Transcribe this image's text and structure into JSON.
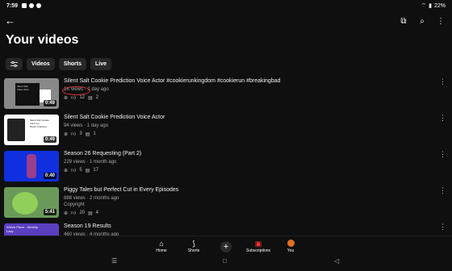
{
  "status": {
    "time": "7:59",
    "battery": "22%"
  },
  "page": {
    "title": "Your videos"
  },
  "chips": [
    "Videos",
    "Shorts",
    "Live"
  ],
  "videos": [
    {
      "title": "Silent Salt Cookie Prediction Voice Actor #cookierunkingdom #cookierun #breakingbad",
      "meta": "1K views · 1 day ago",
      "likes": "12",
      "comments": "2",
      "duration": "0:49",
      "thumb_text": "Silent Salt\nVoice Actor"
    },
    {
      "title": "Silent Salt Cookie Prediction Voice Actor",
      "meta": "94 views · 1 day ago",
      "likes": "3",
      "comments": "1",
      "duration": "0:49",
      "thumb_text": "Silent Salt Cookie\nVoice by:\nBryan Cranston"
    },
    {
      "title": "Season 26 Requesting (Part 2)",
      "meta": "229 views · 1 month ago",
      "likes": "5",
      "comments": "17",
      "duration": "0:40"
    },
    {
      "title": "Piggy Tales but Perfect Cut in Every Episodes",
      "meta": "888 views · 2 months ago",
      "sub": "Copyright",
      "likes": "20",
      "comments": "4",
      "duration": "5:41"
    },
    {
      "title": "Season 19 Results",
      "meta": "460 views · 4 months ago",
      "duration": "",
      "thumb_text": "Which Piece - Weekly Lazy"
    }
  ],
  "nav": {
    "home": "Home",
    "shorts": "Shorts",
    "subscriptions": "Subscriptions",
    "you": "You"
  },
  "colors": {
    "accent": "#ff0000",
    "background": "#0f0f0f",
    "chip": "#272727"
  }
}
